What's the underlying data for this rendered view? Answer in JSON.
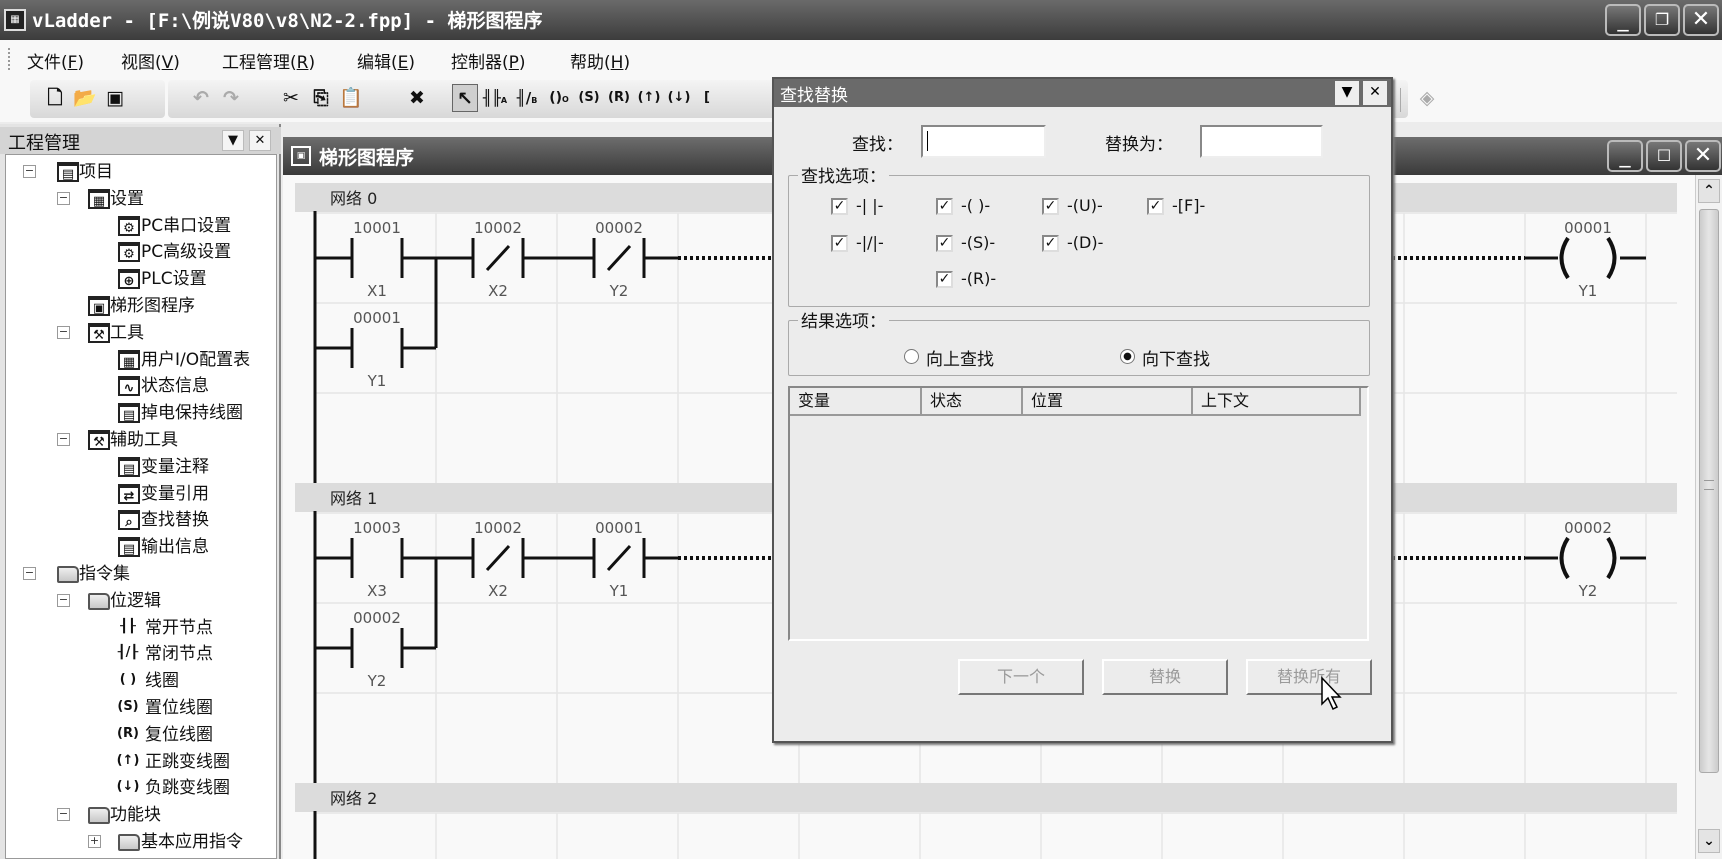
{
  "window": {
    "title": "vLadder - [F:\\例说V80\\v8\\N2-2.fpp] - 梯形图程序",
    "icon": "app-icon"
  },
  "menu": [
    {
      "label": "文件",
      "key": "F"
    },
    {
      "label": "视图",
      "key": "V"
    },
    {
      "label": "工程管理",
      "key": "R"
    },
    {
      "label": "编辑",
      "key": "E"
    },
    {
      "label": "控制器",
      "key": "P"
    },
    {
      "label": "帮助",
      "key": "H"
    }
  ],
  "toolbar": [
    "new-file",
    "open-file",
    "save-all",
    "undo",
    "redo",
    "cut",
    "copy",
    "paste",
    "delete",
    "pointer",
    "normally-open-contact",
    "normally-closed-contact",
    "coil",
    "set-coil",
    "reset-coil",
    "positive-transition-coil",
    "negative-transition-coil",
    "function-block",
    "diamond"
  ],
  "sidebar": {
    "title": "工程管理",
    "tree": [
      {
        "label": "项目",
        "level": 0,
        "expander": "−",
        "icon": "▤"
      },
      {
        "label": "设置",
        "level": 1,
        "expander": "−",
        "icon": "▦"
      },
      {
        "label": "PC串口设置",
        "level": 2,
        "icon": "⚙"
      },
      {
        "label": "PC高级设置",
        "level": 2,
        "icon": "⚙"
      },
      {
        "label": "PLC设置",
        "level": 2,
        "icon": "⊕"
      },
      {
        "label": "梯形图程序",
        "level": 1,
        "icon": "▣"
      },
      {
        "label": "工具",
        "level": 1,
        "expander": "−",
        "icon": "⚒"
      },
      {
        "label": "用户I/O配置表",
        "level": 2,
        "icon": "▦"
      },
      {
        "label": "状态信息",
        "level": 2,
        "icon": "∿"
      },
      {
        "label": "掉电保持线圈",
        "level": 2,
        "icon": "▤"
      },
      {
        "label": "辅助工具",
        "level": 1,
        "expander": "−",
        "icon": "⚒"
      },
      {
        "label": "变量注释",
        "level": 2,
        "icon": "▤"
      },
      {
        "label": "变量引用",
        "level": 2,
        "icon": "⇄"
      },
      {
        "label": "查找替换",
        "level": 2,
        "icon": "⌕"
      },
      {
        "label": "输出信息",
        "level": 2,
        "icon": "▤"
      },
      {
        "label": "指令集",
        "level": 0,
        "expander": "−",
        "icon": "folder"
      },
      {
        "label": "位逻辑",
        "level": 1,
        "expander": "−",
        "icon": "folder"
      },
      {
        "label": "常开节点",
        "level": 2,
        "glyph": "┨┠"
      },
      {
        "label": "常闭节点",
        "level": 2,
        "glyph": "┨/┠"
      },
      {
        "label": "线圈",
        "level": 2,
        "glyph": "( )"
      },
      {
        "label": "置位线圈",
        "level": 2,
        "glyph": "(S)"
      },
      {
        "label": "复位线圈",
        "level": 2,
        "glyph": "(R)"
      },
      {
        "label": "正跳变线圈",
        "level": 2,
        "glyph": "(↑)"
      },
      {
        "label": "负跳变线圈",
        "level": 2,
        "glyph": "(↓)"
      },
      {
        "label": "功能块",
        "level": 1,
        "expander": "−",
        "icon": "folder"
      },
      {
        "label": "基本应用指令",
        "level": 2,
        "expander": "+",
        "icon": "folder"
      }
    ]
  },
  "editor": {
    "title": "梯形图程序",
    "networks": [
      {
        "label": "网络 0",
        "contacts": [
          {
            "row": 0,
            "col": 0,
            "type": "NO",
            "address": "10001",
            "name": "X1"
          },
          {
            "row": 0,
            "col": 1,
            "type": "NC",
            "address": "10002",
            "name": "X2"
          },
          {
            "row": 0,
            "col": 2,
            "type": "NC",
            "address": "00002",
            "name": "Y2"
          },
          {
            "row": 1,
            "col": 0,
            "type": "NO",
            "address": "00001",
            "name": "Y1"
          }
        ],
        "coil": {
          "address": "00001",
          "name": "Y1"
        }
      },
      {
        "label": "网络 1",
        "contacts": [
          {
            "row": 0,
            "col": 0,
            "type": "NO",
            "address": "10003",
            "name": "X3"
          },
          {
            "row": 0,
            "col": 1,
            "type": "NC",
            "address": "10002",
            "name": "X2"
          },
          {
            "row": 0,
            "col": 2,
            "type": "NC",
            "address": "00001",
            "name": "Y1"
          },
          {
            "row": 1,
            "col": 0,
            "type": "NO",
            "address": "00002",
            "name": "Y2"
          }
        ],
        "coil": {
          "address": "00002",
          "name": "Y2"
        }
      },
      {
        "label": "网络 2",
        "contacts": [],
        "coil": null
      }
    ]
  },
  "dialog": {
    "title": "查找替换",
    "find_label": "查找：",
    "find_value": "",
    "replace_label": "替换为：",
    "replace_value": "",
    "find_options_label": "查找选项：",
    "options": [
      {
        "label": "-| |-",
        "checked": true
      },
      {
        "label": "-( )-",
        "checked": true
      },
      {
        "label": "-(U)-",
        "checked": true
      },
      {
        "label": "-[F]-",
        "checked": true
      },
      {
        "label": "-|/|-",
        "checked": true
      },
      {
        "label": "-(S)-",
        "checked": true
      },
      {
        "label": "-(D)-",
        "checked": true
      },
      {
        "label": "-(R)-",
        "checked": true
      }
    ],
    "result_options_label": "结果选项：",
    "search_up": "向上查找",
    "search_down": "向下查找",
    "direction": "down",
    "columns": [
      "变量",
      "状态",
      "位置",
      "上下文"
    ],
    "buttons": {
      "next": "下一个",
      "replace": "替换",
      "replace_all": "替换所有"
    }
  }
}
